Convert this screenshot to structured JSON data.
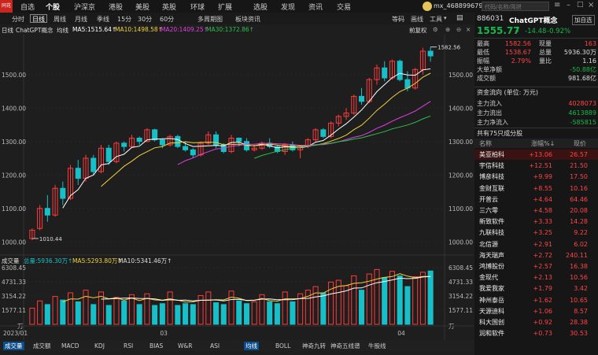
{
  "app": {
    "logo_text": "同花顺",
    "user": "mx_468899679",
    "search_placeholder": "代码/名称/简拼"
  },
  "topnav": [
    "自选",
    "个股",
    "沪深京",
    "港股",
    "美股",
    "英股",
    "环球",
    "扩展",
    "选股",
    "发现",
    "资讯",
    "交易"
  ],
  "topnav_active": 1,
  "top_right": [
    "等码",
    "画线",
    "工具"
  ],
  "toolbar": {
    "items": [
      "分时",
      "日线",
      "周线",
      "月线",
      "季线",
      "15分",
      "30分",
      "60分",
      "多周期图",
      "板块资讯"
    ],
    "selected": 1
  },
  "legend": {
    "period": "日线",
    "name": "ChatGPT概念",
    "indicator": "均线",
    "ma5": "MA5:1515.64↑",
    "ma10": "MA10:1498.58↑",
    "ma20": "MA20:1409.25↑",
    "ma30": "MA30:1372.86↑",
    "right": "前复权"
  },
  "colors": {
    "up": "#ff3b3b",
    "down": "#17c0c8",
    "ma5": "#ffffff",
    "ma10": "#f2d23a",
    "ma20": "#e040e0",
    "ma30": "#2fbf4a",
    "bg": "#1e1e1e",
    "accent": "#0b4d8a"
  },
  "price_axis": {
    "labels": [
      "1500.00",
      "1400.00",
      "1300.00",
      "1200.00",
      "1100.00",
      "1000.00"
    ],
    "values": [
      1500,
      1400,
      1300,
      1200,
      1100,
      1000
    ]
  },
  "price_marks": {
    "high": "1582.56",
    "low": "1010.44"
  },
  "volume_legend": {
    "title": "成交量",
    "total": "总量:5936.30万↑",
    "ma5": "MA5:5293.80万↑",
    "ma10": "MA10:5341.46万↑"
  },
  "volume_axis": {
    "labels": [
      "6308.45",
      "4731.33",
      "3154.22",
      "1577.11",
      "万"
    ]
  },
  "date_axis": {
    "labels": [
      "2023/01",
      "03",
      "04"
    ]
  },
  "bottom_tabs": {
    "items": [
      "成交量",
      "成交额",
      "MACD",
      "KDJ",
      "RSI",
      "BIAS",
      "W&R",
      "ASI",
      "均线",
      "BOLL",
      "神奇九转",
      "神奇五线谱",
      "牛股线"
    ],
    "selected_left": 0,
    "selected_right": 8
  },
  "chart_data": {
    "type": "candlestick",
    "ylim": [
      970,
      1610
    ],
    "candles": [
      [
        1010,
        1040,
        1005,
        1035
      ],
      [
        1040,
        1110,
        1035,
        1100
      ],
      [
        1100,
        1140,
        1060,
        1080
      ],
      [
        1080,
        1170,
        1075,
        1160
      ],
      [
        1160,
        1180,
        1110,
        1130
      ],
      [
        1130,
        1230,
        1125,
        1220
      ],
      [
        1220,
        1245,
        1170,
        1190
      ],
      [
        1190,
        1260,
        1180,
        1250
      ],
      [
        1250,
        1260,
        1200,
        1210
      ],
      [
        1210,
        1290,
        1205,
        1280
      ],
      [
        1280,
        1290,
        1230,
        1240
      ],
      [
        1240,
        1300,
        1235,
        1295
      ],
      [
        1295,
        1300,
        1270,
        1285
      ],
      [
        1285,
        1320,
        1280,
        1310
      ],
      [
        1310,
        1315,
        1290,
        1300
      ],
      [
        1300,
        1340,
        1298,
        1335
      ],
      [
        1335,
        1338,
        1300,
        1305
      ],
      [
        1305,
        1310,
        1280,
        1290
      ],
      [
        1290,
        1320,
        1285,
        1315
      ],
      [
        1315,
        1320,
        1280,
        1285
      ],
      [
        1285,
        1300,
        1270,
        1275
      ],
      [
        1275,
        1280,
        1250,
        1260
      ],
      [
        1260,
        1300,
        1255,
        1295
      ],
      [
        1295,
        1330,
        1290,
        1320
      ],
      [
        1320,
        1330,
        1280,
        1290
      ],
      [
        1290,
        1295,
        1265,
        1270
      ],
      [
        1270,
        1320,
        1265,
        1310
      ],
      [
        1310,
        1312,
        1285,
        1300
      ],
      [
        1300,
        1310,
        1270,
        1275
      ],
      [
        1275,
        1290,
        1270,
        1280
      ],
      [
        1280,
        1300,
        1275,
        1295
      ],
      [
        1295,
        1310,
        1280,
        1285
      ],
      [
        1285,
        1290,
        1265,
        1270
      ],
      [
        1270,
        1295,
        1260,
        1290
      ],
      [
        1290,
        1300,
        1270,
        1275
      ],
      [
        1275,
        1290,
        1250,
        1285
      ],
      [
        1285,
        1310,
        1280,
        1305
      ],
      [
        1305,
        1340,
        1300,
        1335
      ],
      [
        1335,
        1340,
        1310,
        1315
      ],
      [
        1315,
        1360,
        1310,
        1355
      ],
      [
        1355,
        1380,
        1345,
        1375
      ],
      [
        1375,
        1400,
        1365,
        1385
      ],
      [
        1385,
        1440,
        1380,
        1435
      ],
      [
        1435,
        1460,
        1410,
        1420
      ],
      [
        1420,
        1490,
        1415,
        1485
      ],
      [
        1485,
        1530,
        1470,
        1520
      ],
      [
        1520,
        1540,
        1480,
        1490
      ],
      [
        1490,
        1545,
        1485,
        1540
      ],
      [
        1540,
        1545,
        1480,
        1485
      ],
      [
        1485,
        1510,
        1450,
        1460
      ],
      [
        1460,
        1520,
        1455,
        1515
      ],
      [
        1515,
        1580,
        1500,
        1570
      ],
      [
        1570,
        1582.56,
        1538.67,
        1555.77
      ]
    ],
    "volume": [
      1800,
      2600,
      2200,
      3100,
      2700,
      3500,
      2500,
      3800,
      2200,
      3600,
      2100,
      3000,
      2600,
      3300,
      2200,
      3400,
      2100,
      2300,
      3600,
      2100,
      2300,
      2200,
      3200,
      3600,
      2400,
      2200,
      3700,
      2600,
      2300,
      2500,
      3300,
      2500,
      2300,
      3600,
      2500,
      3400,
      3800,
      4200,
      3500,
      4700,
      4900,
      4300,
      5400,
      3800,
      5600,
      6100,
      5200,
      5900,
      5400,
      4200,
      5300,
      5800,
      5936
    ]
  },
  "quote": {
    "code": "886031",
    "name": "ChatGPT概念",
    "price": "1555.77",
    "arrow": "↓",
    "change": "-14.48",
    "pct": "-0.92%",
    "add_btn": "加自选"
  },
  "stats": [
    {
      "l1": "最高",
      "v1": "1582.56",
      "l2": "现量",
      "v2": "163",
      "c1": "red",
      "c2": "red"
    },
    {
      "l1": "最低",
      "v1": "1538.67",
      "l2": "总量",
      "v2": "5936.30万",
      "c1": "red",
      "c2": "white"
    },
    {
      "l1": "振幅",
      "v1": "2.79%",
      "l2": "量比",
      "v2": "1.16",
      "c1": "red",
      "c2": "white"
    },
    {
      "l1": "大单净额",
      "v1": "",
      "l2": "",
      "v2": "-50.88亿",
      "c1": "white",
      "c2": "green"
    },
    {
      "l1": "成交额",
      "v1": "",
      "l2": "",
      "v2": "981.68亿",
      "c1": "white",
      "c2": "white"
    }
  ],
  "flow": {
    "title": "资金流向 (单位: 万元)",
    "rows": [
      {
        "label": "主力流入",
        "value": "4028073",
        "color": "red"
      },
      {
        "label": "主力流出",
        "value": "4613889",
        "color": "green"
      },
      {
        "label": "主力净流入",
        "value": "-585815",
        "color": "green"
      }
    ]
  },
  "constituents": {
    "title": "共有75只成分股",
    "headers": [
      "名称",
      "涨幅%↓",
      "现价"
    ],
    "rows": [
      {
        "name": "美亚柏科",
        "pct": "+13.06",
        "price": "26.57"
      },
      {
        "name": "宇信科技",
        "pct": "+12.51",
        "price": "21.50"
      },
      {
        "name": "博彦科技",
        "pct": "+9.99",
        "price": "17.50"
      },
      {
        "name": "金财互联",
        "pct": "+8.55",
        "price": "10.16"
      },
      {
        "name": "开普云",
        "pct": "+4.64",
        "price": "64.46"
      },
      {
        "name": "三六零",
        "pct": "+4.58",
        "price": "20.08"
      },
      {
        "name": "新致软件",
        "pct": "+3.33",
        "price": "14.28"
      },
      {
        "name": "九联科技",
        "pct": "+3.25",
        "price": "9.22"
      },
      {
        "name": "北信源",
        "pct": "+2.91",
        "price": "6.02"
      },
      {
        "name": "海天瑞声",
        "pct": "+2.72",
        "price": "240.11"
      },
      {
        "name": "鸿博股份",
        "pct": "+2.57",
        "price": "16.38"
      },
      {
        "name": "金现代",
        "pct": "+2.13",
        "price": "10.56"
      },
      {
        "name": "我爱我家",
        "pct": "+1.79",
        "price": "3.42"
      },
      {
        "name": "神州泰岳",
        "pct": "+1.62",
        "price": "10.65"
      },
      {
        "name": "天源迪科",
        "pct": "+1.06",
        "price": "8.57"
      },
      {
        "name": "科大国创",
        "pct": "+0.92",
        "price": "28.38"
      },
      {
        "name": "润和软件",
        "pct": "+0.73",
        "price": "30.53"
      }
    ]
  }
}
